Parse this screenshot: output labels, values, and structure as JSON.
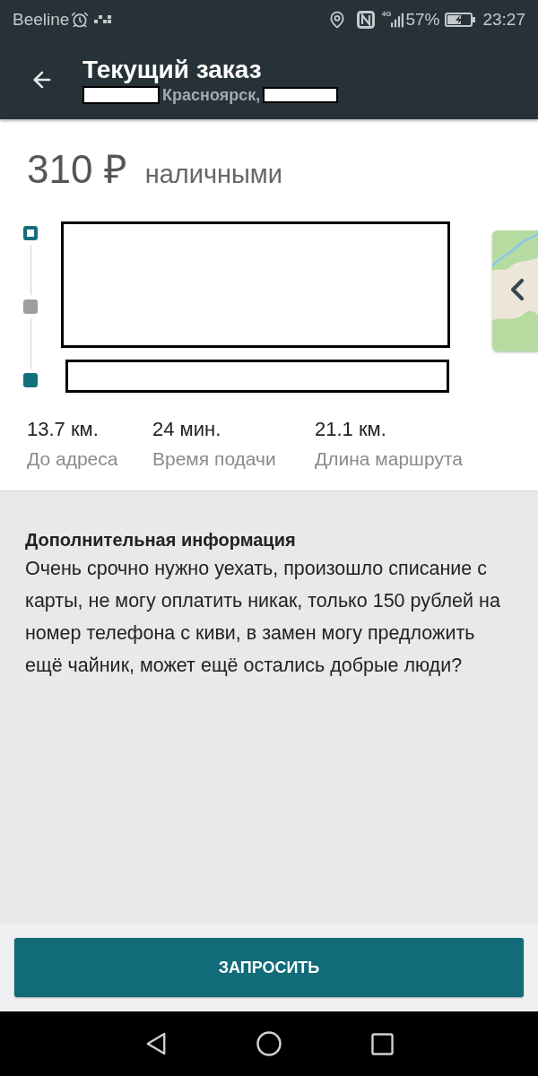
{
  "status_bar": {
    "carrier": "Beeline",
    "network": "4G",
    "battery": "57%",
    "time": "23:27"
  },
  "toolbar": {
    "title": "Текущий заказ",
    "subtitle": "Красноярск,"
  },
  "order": {
    "price": "310 ₽",
    "payment": "наличными"
  },
  "route": {
    "points": [
      {
        "kind": "start",
        "color": "#136f7c"
      },
      {
        "kind": "stop",
        "color": "#9e9e9e"
      },
      {
        "kind": "end",
        "color": "#136f7c"
      }
    ]
  },
  "stats": [
    {
      "value": "13.7 км.",
      "label": "До адреса"
    },
    {
      "value": "24 мин.",
      "label": "Время подачи"
    },
    {
      "value": "21.1 км.",
      "label": "Длина маршрута"
    }
  ],
  "info": {
    "title": "Дополнительная информация",
    "text": "Очень срочно нужно уехать, произошло списание с карты, не могу оплатить никак, только 150 рублей на номер телефона с киви, в замен могу предложить ещё чайник, может ещё остались добрые люди?"
  },
  "action_button": "ЗАПРОСИТЬ"
}
